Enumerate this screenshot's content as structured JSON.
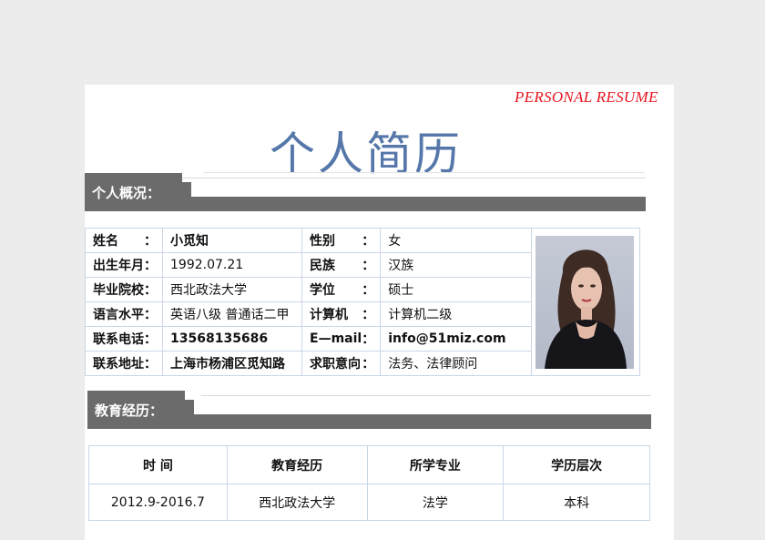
{
  "header": {
    "brand": "PERSONAL    RESUME",
    "title": "个人简历"
  },
  "sections": {
    "overview": "个人概况：",
    "education": "教育经历："
  },
  "profile": {
    "rows": [
      {
        "k1": "姓名",
        "v1": "小觅知",
        "k2": "性别",
        "v2": "女"
      },
      {
        "k1": "出生年月",
        "v1": "1992.07.21",
        "k2": "民族",
        "v2": "汉族"
      },
      {
        "k1": "毕业院校",
        "v1": "西北政法大学",
        "k2": "学位",
        "v2": "硕士"
      },
      {
        "k1": "语言水平",
        "v1": "英语八级  普通话二甲",
        "k2": "计算机",
        "v2": "计算机二级"
      },
      {
        "k1": "联系电话",
        "v1": "13568135686",
        "k2": "E—mail",
        "v2": "info@51miz.com"
      },
      {
        "k1": "联系地址",
        "v1": "上海市杨浦区觅知路",
        "k2": "求职意向",
        "v2": "法务、法律顾问"
      }
    ]
  },
  "education": {
    "headers": [
      "时    间",
      "教育经历",
      "所学专业",
      "学历层次"
    ],
    "rows": [
      [
        "2012.9-2016.7",
        "西北政法大学",
        "法学",
        "本科"
      ]
    ]
  }
}
